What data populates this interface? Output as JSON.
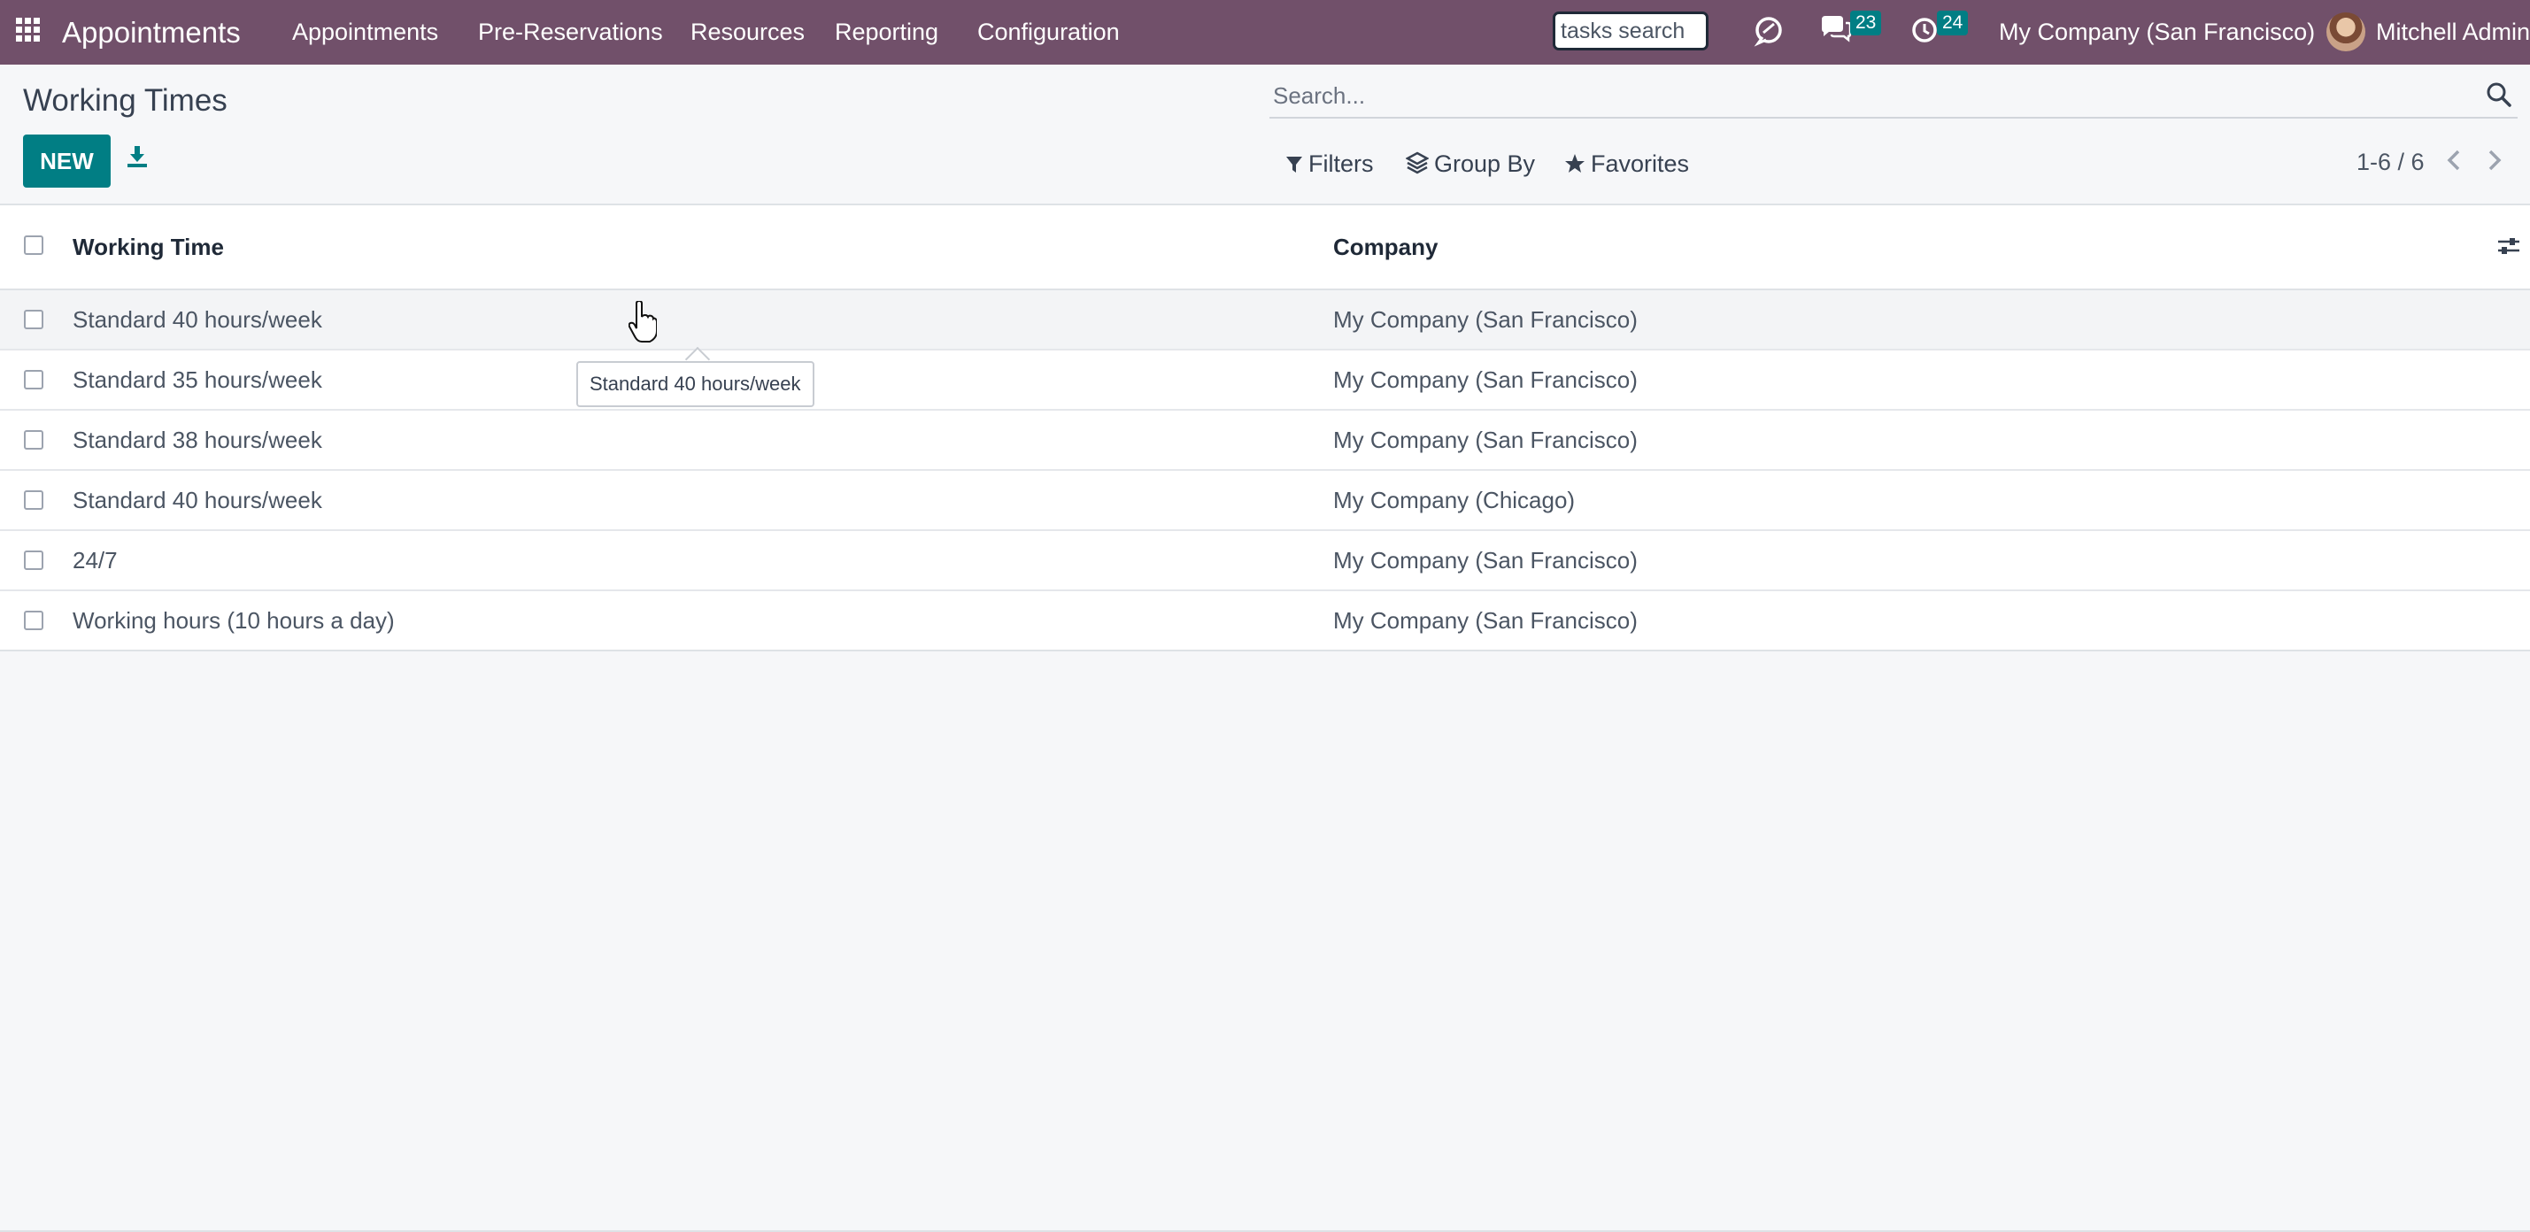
{
  "navbar": {
    "brand": "Appointments",
    "menu": [
      "Appointments",
      "Pre-Reservations",
      "Resources",
      "Reporting",
      "Configuration"
    ],
    "tasks_search_value": "tasks search",
    "messages_count": "23",
    "activities_count": "24",
    "company": "My Company (San Francisco)",
    "user": "Mitchell Admin"
  },
  "control_panel": {
    "title": "Working Times",
    "new_label": "NEW",
    "search_placeholder": "Search...",
    "filters_label": "Filters",
    "group_by_label": "Group By",
    "favorites_label": "Favorites",
    "pager": "1-6 / 6"
  },
  "table": {
    "columns": [
      "Working Time",
      "Company"
    ],
    "rows": [
      {
        "name": "Standard 40 hours/week",
        "company": "My Company (San Francisco)"
      },
      {
        "name": "Standard 35 hours/week",
        "company": "My Company (San Francisco)"
      },
      {
        "name": "Standard 38 hours/week",
        "company": "My Company (San Francisco)"
      },
      {
        "name": "Standard 40 hours/week",
        "company": "My Company (Chicago)"
      },
      {
        "name": "24/7",
        "company": "My Company (San Francisco)"
      },
      {
        "name": "Working hours (10 hours a day)",
        "company": "My Company (San Francisco)"
      }
    ]
  },
  "tooltip": "Standard 40 hours/week",
  "colors": {
    "navbar": "#71506a",
    "primary": "#017e84"
  }
}
